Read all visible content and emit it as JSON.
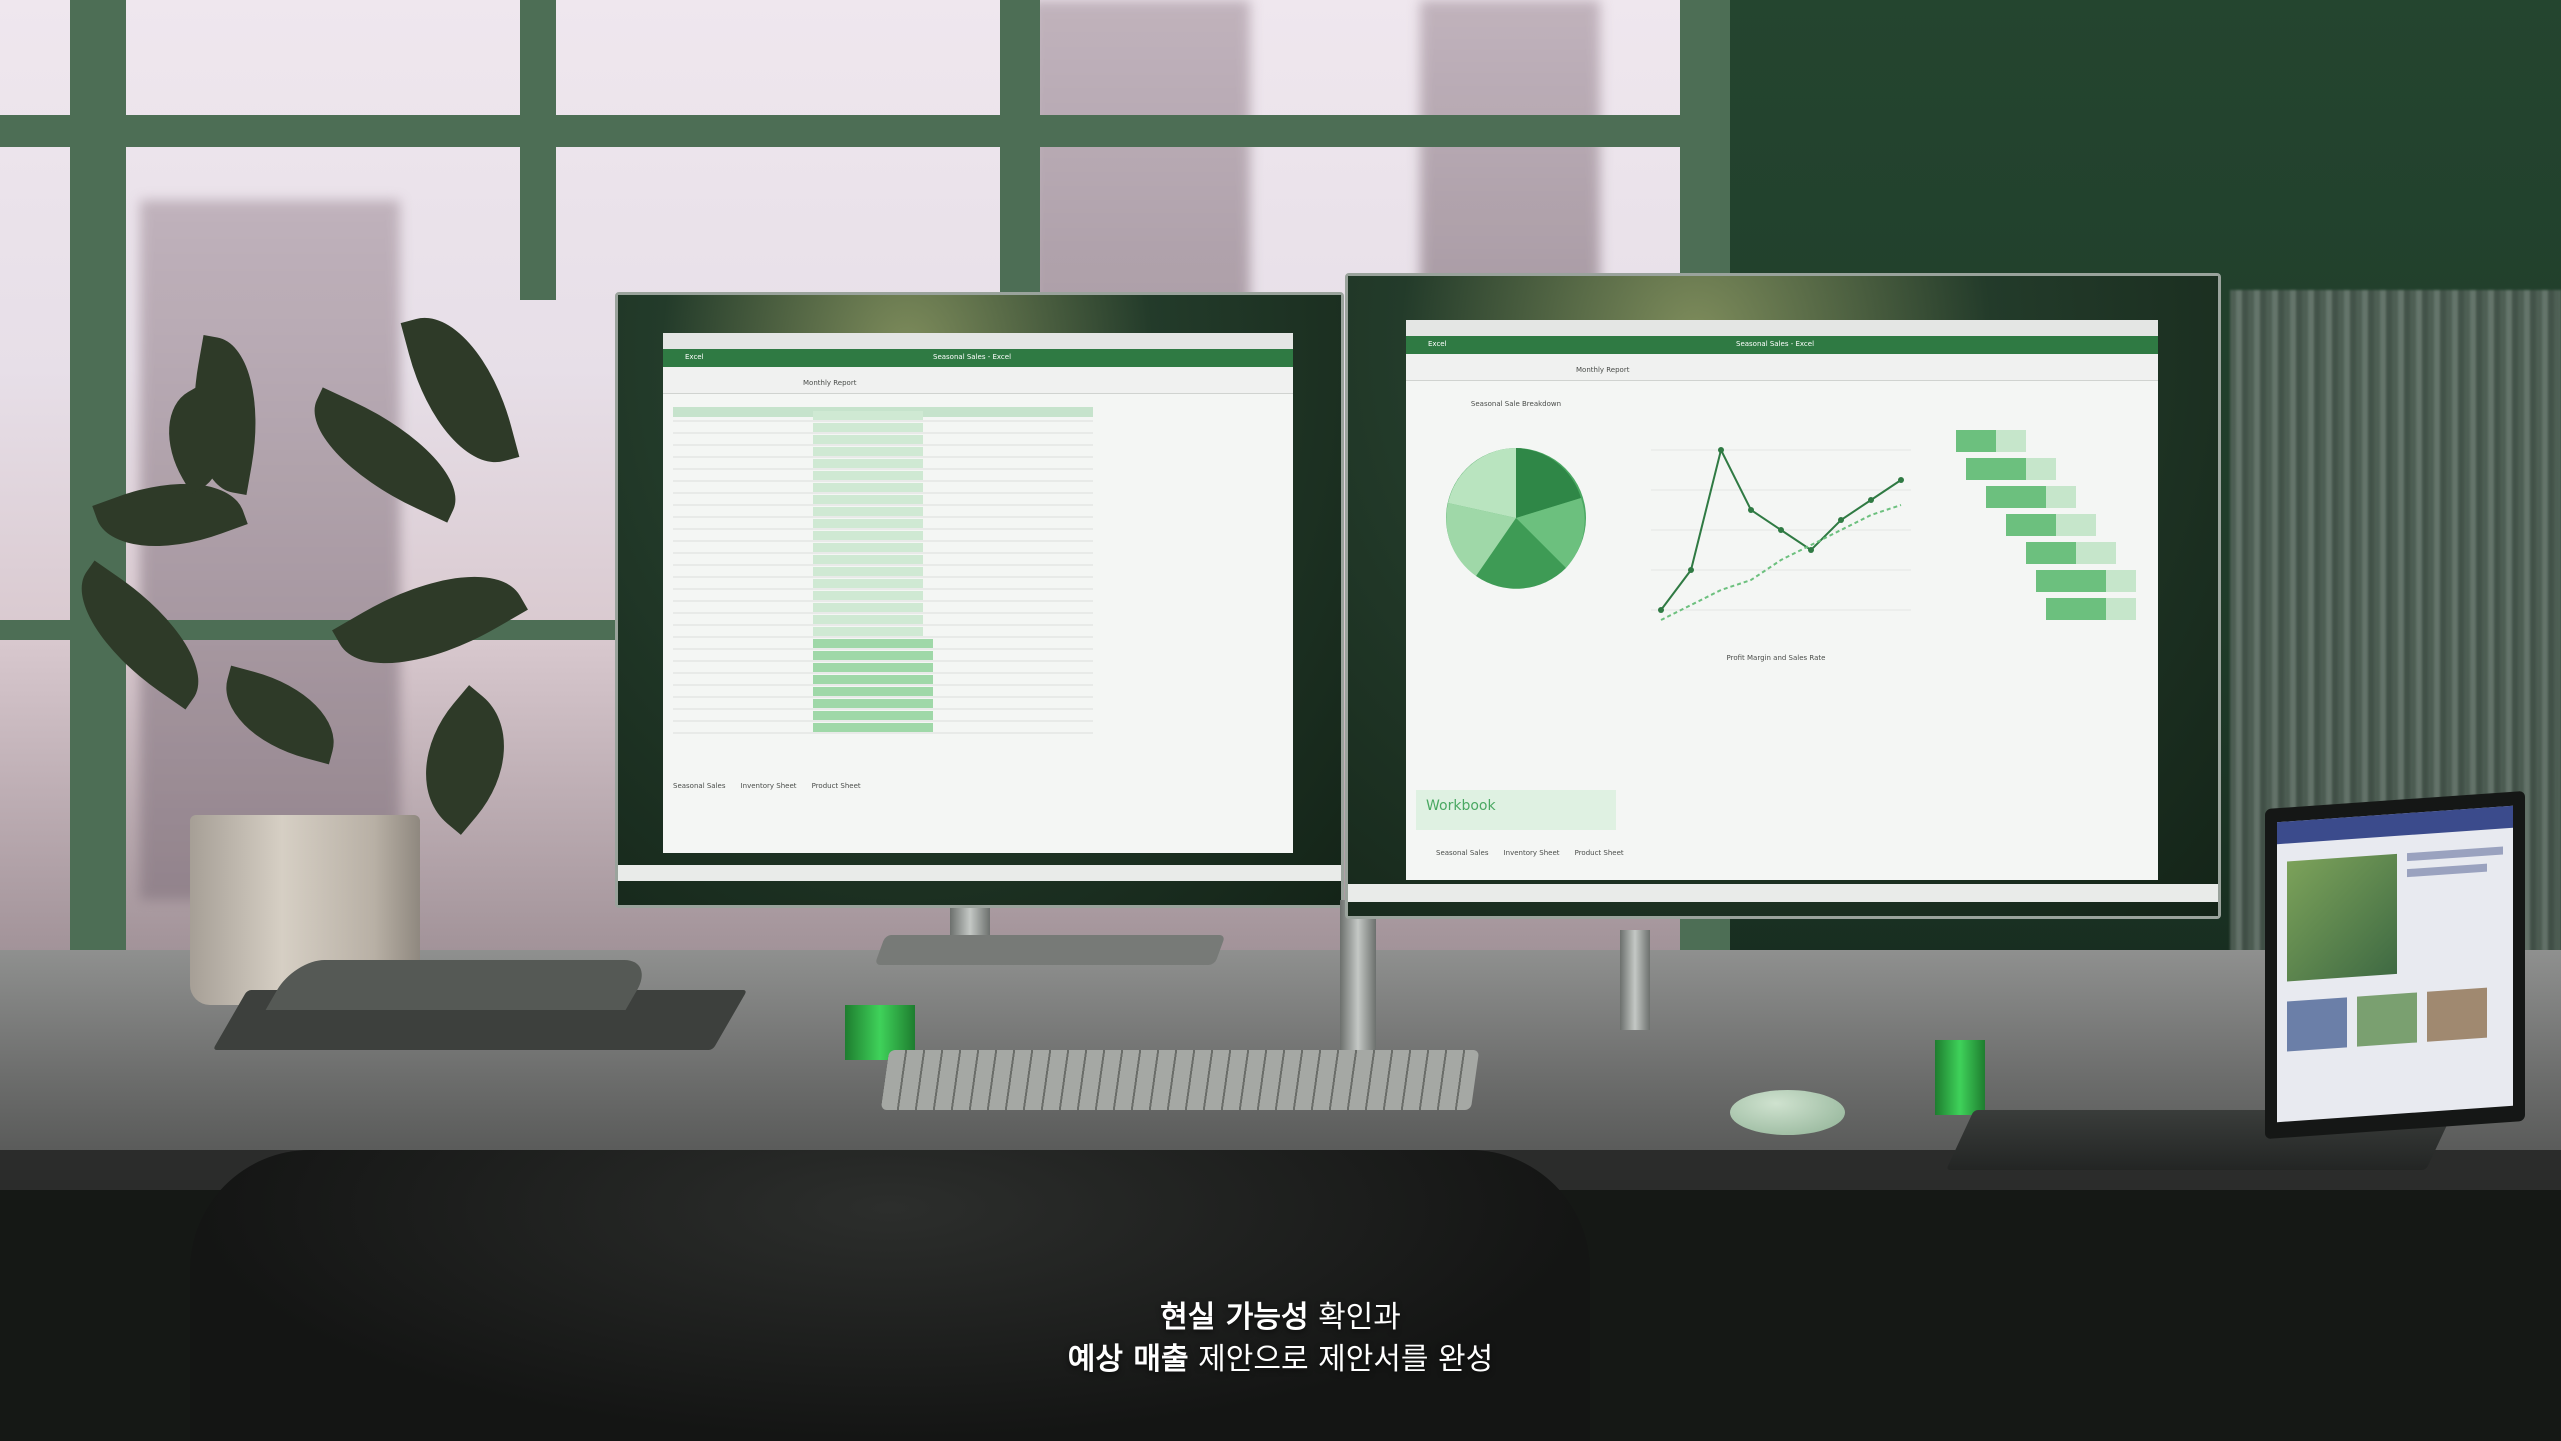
{
  "scene": {
    "description_visible": "Office desk with two monitors running a spreadsheet application, a plant, a notebook, keyboard, mouse and a laptop."
  },
  "left_monitor": {
    "app_name": "Excel",
    "title": "Seasonal Sales - Excel",
    "tab_label": "Monthly Report",
    "sheet_tabs": [
      "Seasonal Sales",
      "Inventory Sheet",
      "Product Sheet"
    ]
  },
  "right_monitor": {
    "app_name": "Excel",
    "title": "Seasonal Sales - Excel",
    "tab_label": "Monthly Report",
    "chart_title": "Seasonal Sale Breakdown",
    "line_chart_label": "Profit Margin and Sales Rate",
    "workbook_label": "Workbook",
    "sheet_tabs": [
      "Seasonal Sales",
      "Inventory Sheet",
      "Product Sheet"
    ]
  },
  "subtitle": {
    "line1_bold": "현실 가능성",
    "line1_rest": " 확인과",
    "line2_bold": "예상 매출",
    "line2_rest": " 제안으로 제안서를 완성"
  },
  "colors": {
    "excel_green": "#2f7a43",
    "chart_green_dark": "#3e9b55",
    "chart_green_light": "#9fd8a8"
  }
}
